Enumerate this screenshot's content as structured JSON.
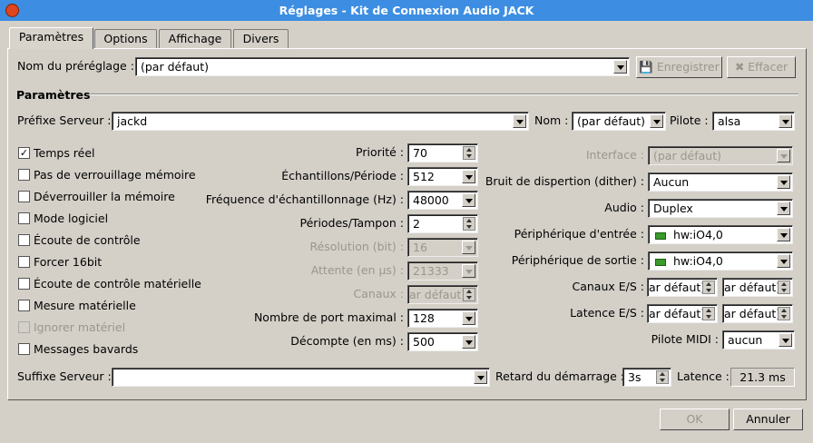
{
  "window": {
    "title": "Réglages - Kit de Connexion Audio JACK"
  },
  "tabs": [
    "Paramètres",
    "Options",
    "Affichage",
    "Divers"
  ],
  "preset": {
    "label": "Nom du préréglage :",
    "value": "(par défaut)",
    "save": "Enregistrer",
    "delete": "Effacer"
  },
  "section": "Paramètres",
  "server": {
    "prefix_label": "Préfixe Serveur :",
    "prefix": "jackd",
    "name_label": "Nom :",
    "name": "(par défaut)",
    "driver_label": "Pilote :",
    "driver": "alsa"
  },
  "checkboxes": [
    {
      "label": "Temps réel",
      "checked": true,
      "disabled": false
    },
    {
      "label": "Pas de verrouillage mémoire",
      "checked": false,
      "disabled": false
    },
    {
      "label": "Déverrouiller la mémoire",
      "checked": false,
      "disabled": false
    },
    {
      "label": "Mode logiciel",
      "checked": false,
      "disabled": false
    },
    {
      "label": "Écoute de contrôle",
      "checked": false,
      "disabled": false
    },
    {
      "label": "Forcer 16bit",
      "checked": false,
      "disabled": false
    },
    {
      "label": "Écoute de contrôle matérielle",
      "checked": false,
      "disabled": false
    },
    {
      "label": "Mesure matérielle",
      "checked": false,
      "disabled": false
    },
    {
      "label": "Ignorer matériel",
      "checked": false,
      "disabled": true
    },
    {
      "label": "Messages bavards",
      "checked": false,
      "disabled": false
    }
  ],
  "middle": [
    {
      "label": "Priorité :",
      "value": "70",
      "kind": "spin",
      "disabled": false
    },
    {
      "label": "Échantillons/Période :",
      "value": "512",
      "kind": "combo",
      "disabled": false
    },
    {
      "label": "Fréquence d'échantillonnage (Hz) :",
      "value": "48000",
      "kind": "combo",
      "disabled": false
    },
    {
      "label": "Périodes/Tampon :",
      "value": "2",
      "kind": "spin",
      "disabled": false
    },
    {
      "label": "Résolution (bit) :",
      "value": "16",
      "kind": "combo",
      "disabled": true
    },
    {
      "label": "Attente (en µs) :",
      "value": "21333",
      "kind": "combo",
      "disabled": true
    },
    {
      "label": "Canaux :",
      "value": "ar défaut)",
      "kind": "spin",
      "disabled": true
    },
    {
      "label": "Nombre de port maximal :",
      "value": "128",
      "kind": "combo",
      "disabled": false
    },
    {
      "label": "Décompte (en ms) :",
      "value": "500",
      "kind": "combo",
      "disabled": false
    }
  ],
  "right": [
    {
      "label": "Interface :",
      "value": "(par défaut)",
      "disabled": true
    },
    {
      "label": "Bruit de dispertion (dither) :",
      "value": "Aucun",
      "disabled": false
    },
    {
      "label": "Audio :",
      "value": "Duplex",
      "disabled": false
    },
    {
      "label": "Périphérique d'entrée :",
      "value": "hw:iO4,0",
      "disabled": false,
      "card": true
    },
    {
      "label": "Périphérique de sortie :",
      "value": "hw:iO4,0",
      "disabled": false,
      "card": true
    }
  ],
  "channels": {
    "label": "Canaux E/S :",
    "in": "ar défaut)",
    "out": "ar défaut)"
  },
  "latency_io": {
    "label": "Latence E/S :",
    "in": "ar défaut)",
    "out": "ar défaut)"
  },
  "midi": {
    "label": "Pilote MIDI :",
    "value": "aucun"
  },
  "suffix": {
    "label": "Suffixe Serveur :",
    "value": ""
  },
  "startup": {
    "label": "Retard du démarrage :",
    "value": "3s"
  },
  "latency": {
    "label": "Latence :",
    "value": "21.3 ms"
  },
  "buttons": {
    "ok": "OK",
    "cancel": "Annuler"
  }
}
